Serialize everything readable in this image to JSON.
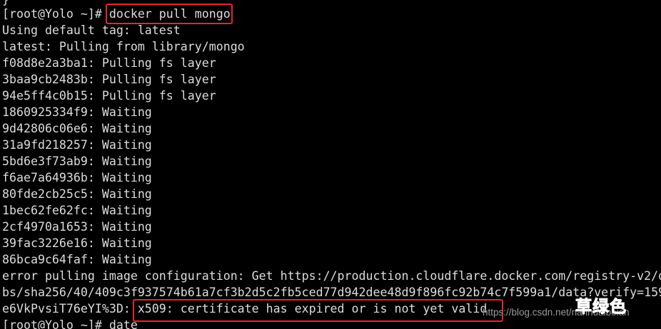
{
  "terminal": {
    "prev_line": "}",
    "lines": [
      "[root@Yolo ~]# docker pull mongo",
      "Using default tag: latest",
      "latest: Pulling from library/mongo",
      "f08d8e2a3ba1: Pulling fs layer",
      "3baa9cb2483b: Pulling fs layer",
      "94e5ff4c0b15: Pulling fs layer",
      "1860925334f9: Waiting",
      "9d42806c06e6: Waiting",
      "31a9fd218257: Waiting",
      "5bd6e3f73ab9: Waiting",
      "f6ae7a64936b: Waiting",
      "80fde2cb25c5: Waiting",
      "1bec62fe62fc: Waiting",
      "2cf4970a1653: Waiting",
      "39fac3226e16: Waiting",
      "86bca9c64faf: Waiting",
      "error pulling image configuration: Get https://production.cloudflare.docker.com/registry-v2/d",
      "bs/sha256/40/409c3f937574b61a7cf3b2d5c2fb5ced77d942dee48d9f896fc92b74c7f599a1/data?verify=159",
      "e6VkPvsiT76eYI%3D: x509: certificate has expired or is not yet valid",
      "[root@Yolo ~]# date"
    ],
    "highlighted_command": "docker pull mongo",
    "highlighted_error": "x509: certificate has expired or is not yet valid"
  },
  "watermark": {
    "url": "https://blog.csdn.net/nanhuaibeian",
    "logo": "草绿色"
  },
  "colors": {
    "background": "#000000",
    "foreground": "#dcdcdc",
    "highlight_border": "#e8262c",
    "logo_green": "#5fd35a"
  }
}
